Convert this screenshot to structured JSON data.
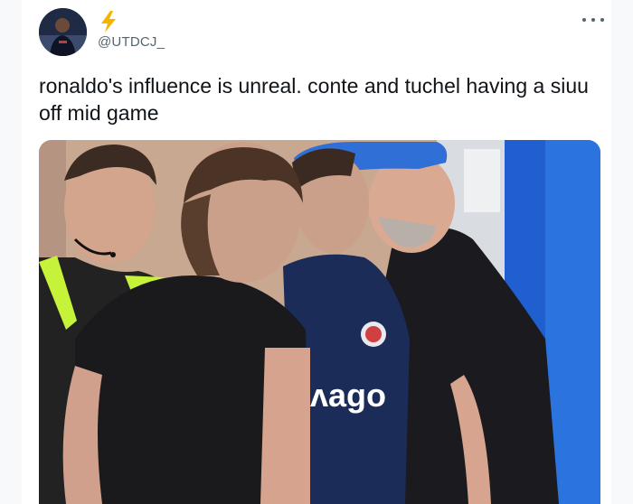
{
  "tweet": {
    "display_name_emoji": "⚡",
    "handle": "@UTDCJ_",
    "text": "ronaldo's influence is unreal. conte and tuchel having a siuu off mid game",
    "more_icon": "more-dots-icon",
    "avatar_icon": "avatar-image"
  },
  "media": {
    "shirt_sponsor_text": "ʌago"
  },
  "colors": {
    "text": "#0f1419",
    "secondary": "#536471",
    "bolt": "#f4b400",
    "cap_blue": "#2f6fd6",
    "kit_blue": "#1c2c58",
    "referee_yellow": "#c6f23a"
  }
}
